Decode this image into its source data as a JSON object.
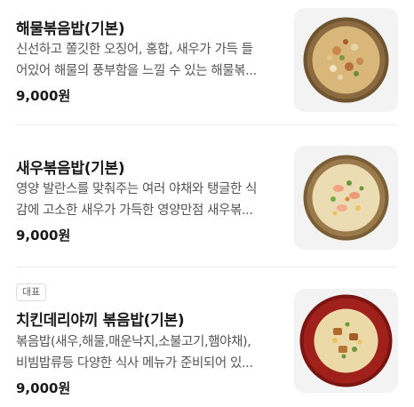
{
  "menu": {
    "items": [
      {
        "title": "해물볶음밥(기본)",
        "desc_lines": [
          "신선하고 쫄깃한 오징어, 홍합, 새우가 가득 들",
          "어있어 해물의 풍부함을 느낄 수 있는 해물볶..."
        ],
        "price": "9,000원",
        "image_icon": "seafood-fried-rice-photo",
        "plate_color": "#8a6a3e"
      },
      {
        "title": "새우볶음밥(기본)",
        "desc_lines": [
          "영양 발란스를 맞춰주는 여러 야채와 탱글한 식",
          "감에 고소한 새우가 가득한 영양만점 새우볶..."
        ],
        "price": "9,000원",
        "image_icon": "shrimp-fried-rice-photo",
        "plate_color": "#9a7a4a"
      },
      {
        "badge": "대표",
        "title": "치킨데리야끼 볶음밥(기본)",
        "desc_lines": [
          "볶음밥(새우,해물,매운낙지,소불고기,햄야채),",
          "비빔밥류등 다양한 식사 메뉴가 준비되어 있..."
        ],
        "price": "9,000원",
        "image_icon": "chicken-teriyaki-fried-rice-photo",
        "plate_color": "#a0201c"
      }
    ]
  }
}
